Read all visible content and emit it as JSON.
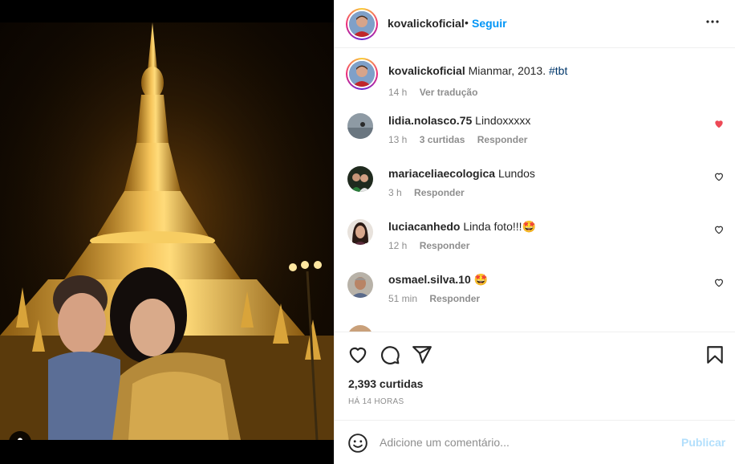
{
  "post": {
    "username": "kovalickoficial",
    "follow_label": "Seguir",
    "separator": "•",
    "more_label": "•••"
  },
  "caption": {
    "username": "kovalickoficial",
    "text": "Mianmar, 2013.",
    "hashtag": "#tbt",
    "time": "14 h",
    "translate_label": "Ver tradução"
  },
  "comments": [
    {
      "username": "lidia.nolasco.75",
      "text": "Lindoxxxxx",
      "time": "13 h",
      "likes": "3 curtidas",
      "reply": "Responder",
      "liked": true
    },
    {
      "username": "mariaceliaecologica",
      "text": "Lundos",
      "time": "3 h",
      "reply": "Responder",
      "liked": false
    },
    {
      "username": "luciacanhedo",
      "text": "Linda foto!!!🤩",
      "time": "12 h",
      "reply": "Responder",
      "liked": false
    },
    {
      "username": "osmael.silva.10",
      "text": "🤩",
      "time": "51 min",
      "reply": "Responder",
      "liked": false
    }
  ],
  "stats": {
    "likes": "2,393 curtidas",
    "time_ago": "HÁ 14 HORAS"
  },
  "composer": {
    "placeholder": "Adicione um comentário...",
    "publish_label": "Publicar"
  },
  "colors": {
    "accent": "#0095f6",
    "liked": "#ed4956",
    "muted": "#8e8e8e",
    "publish_disabled": "#b2dffc"
  }
}
